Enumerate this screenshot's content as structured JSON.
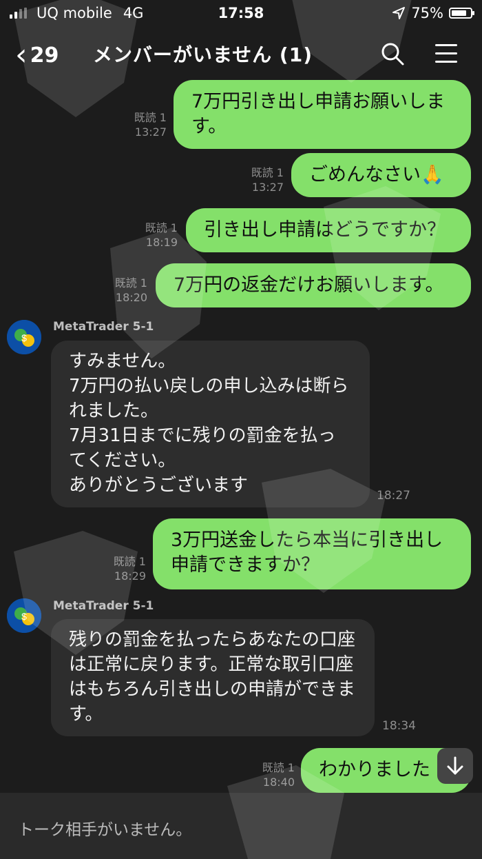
{
  "status_bar": {
    "carrier": "UQ mobile",
    "network": "4G",
    "time": "17:58",
    "battery": "75%"
  },
  "header": {
    "back_count": "29",
    "title": "メンバーがいません (1)"
  },
  "messages": [
    {
      "text": "7万円引き出し申請お願いします。",
      "read": "既読 1",
      "time": "13:27"
    },
    {
      "text": "ごめんなさい🙏",
      "read": "既読 1",
      "time": "13:27"
    },
    {
      "text": "引き出し申請はどうですか？",
      "read": "既読 1",
      "time": "18:19"
    },
    {
      "text": "7万円の返金だけお願いします。",
      "read": "既読 1",
      "time": "18:20"
    },
    {
      "sender": "MetaTrader 5-1",
      "text": "すみません。\n7万円の払い戻しの申し込みは断られました。\n7月31日までに残りの罰金を払ってください。\nありがとうございます",
      "time": "18:27"
    },
    {
      "text": "3万円送金したら本当に引き出し申請できますか？",
      "read": "既読 1",
      "time": "18:29"
    },
    {
      "sender": "MetaTrader 5-1",
      "text": "残りの罰金を払ったらあなたの口座は正常に戻ります。正常な取引口座はもちろん引き出しの申請ができます。",
      "time": "18:34"
    },
    {
      "text": "わかりました",
      "read": "既読 1",
      "time": "18:40"
    }
  ],
  "footer": {
    "text": "トーク相手がいません。"
  }
}
